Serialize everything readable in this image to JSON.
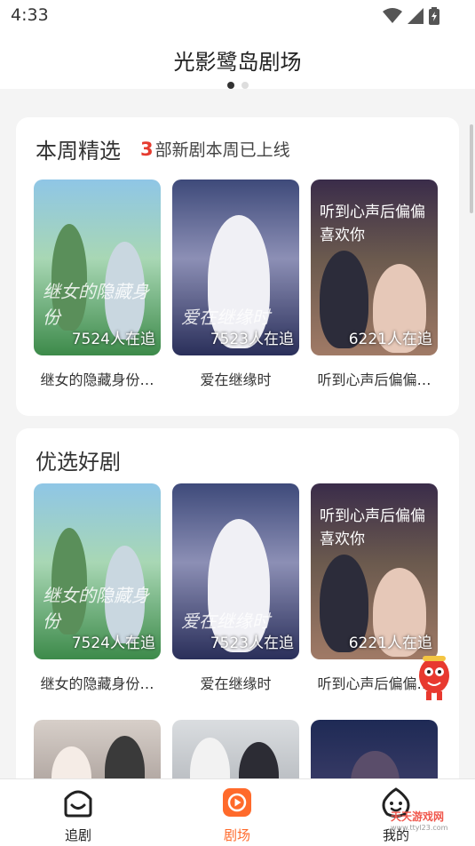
{
  "status_bar": {
    "time": "4:33"
  },
  "header": {
    "title": "光影鹭岛剧场"
  },
  "section_weekly": {
    "title": "本周精选",
    "new_count": "3",
    "subtitle_suffix": "部新剧本周已上线",
    "items": [
      {
        "title": "继女的隐藏身份…",
        "count": "7524人在追",
        "art": "继女的隐藏身份"
      },
      {
        "title": "爱在继缘时",
        "count": "7523人在追",
        "art": "爱在继缘时"
      },
      {
        "title": "听到心声后偏偏…",
        "count": "6221人在追",
        "art": "听到心声后偏偏喜欢你"
      }
    ]
  },
  "section_featured": {
    "title": "优选好剧",
    "items": [
      {
        "title": "继女的隐藏身份…",
        "count": "7524人在追",
        "art": "继女的隐藏身份"
      },
      {
        "title": "爱在继缘时",
        "count": "7523人在追",
        "art": "爱在继缘时"
      },
      {
        "title": "听到心声后偏偏…",
        "count": "6221人在追",
        "art": "听到心声后偏偏喜欢你"
      }
    ]
  },
  "tabbar": {
    "tabs": [
      {
        "label": "追剧",
        "icon": "smile-icon"
      },
      {
        "label": "剧场",
        "icon": "play-icon",
        "active": true
      },
      {
        "label": "我的",
        "icon": "profile-face-icon"
      }
    ]
  },
  "watermark": {
    "text": "天天游戏网",
    "url": "www.ttyl23.com"
  },
  "colors": {
    "accent": "#ff6a2b",
    "highlight": "#e53b2f"
  }
}
